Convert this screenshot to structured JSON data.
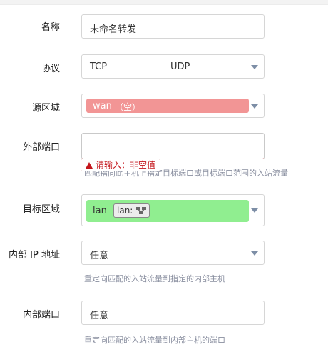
{
  "fields": {
    "name": {
      "label": "名称",
      "value": "未命名转发"
    },
    "protocol": {
      "label": "协议",
      "options": [
        "TCP",
        "UDP"
      ]
    },
    "source_zone": {
      "label": "源区域",
      "value": "wan",
      "empty_tag": "（空）"
    },
    "external_port": {
      "label": "外部端口",
      "value": "",
      "error": "请输入：非空值",
      "hint": "匹配指向此主机上指定目标端口或目标端口范围的入站流量"
    },
    "dest_zone": {
      "label": "目标区域",
      "value": "lan",
      "chip_label": "lan:"
    },
    "internal_ip": {
      "label": "内部 IP 地址",
      "value": "任意",
      "hint": "重定向匹配的入站流量到指定的内部主机"
    },
    "internal_port": {
      "label": "内部端口",
      "value": "任意",
      "hint": "重定向匹配的入站流量到内部主机的端口"
    }
  },
  "colors": {
    "source_zone_bg": "#f29595",
    "dest_zone_bg": "#90ee90",
    "error": "#c4161c",
    "hint": "#8a8fa0"
  },
  "icons": {
    "dest_zone_chip": "network-devices-icon",
    "error": "warning-triangle-icon",
    "dropdown": "caret-down-icon"
  }
}
